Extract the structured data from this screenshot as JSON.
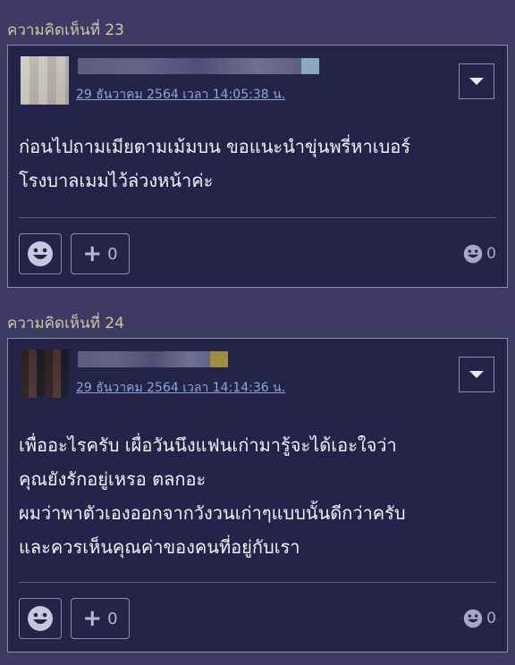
{
  "comments": [
    {
      "section_title": "ความคิดเห็นที่ 23",
      "timestamp": "29 ธันวาคม 2564 เวลา 14:05:38 น.",
      "text_lines": [
        "ก่อนไปถามเมียตามเม้มบน ขอแนะนำขุ่นพรี่หาเบอร์",
        "โรงบาลเมมไว้ล่วงหน้าค่ะ"
      ],
      "plus_count": "0",
      "emotion_count": "0",
      "icons": [
        "smiley-icon",
        "plus-icon",
        "menu-dropdown-icon"
      ]
    },
    {
      "section_title": "ความคิดเห็นที่ 24",
      "timestamp": "29 ธันวาคม 2564 เวลา 14:14:36 น.",
      "text_lines": [
        "เพื่ออะไรครับ เผื่อวันนึงแฟนเก่ามารู้จะได้เอะใจว่า",
        "คุณยังรักอยู่เหรอ ตลกอะ",
        "ผมว่าพาตัวเองออกจากวังวนเก่าๆแบบนั้นดีกว่าครับ",
        "และควรเห็นคุณค่าของคนที่อยู่กับเรา"
      ],
      "plus_count": "0",
      "emotion_count": "0",
      "icons": [
        "smiley-icon",
        "plus-icon",
        "menu-dropdown-icon"
      ]
    }
  ]
}
